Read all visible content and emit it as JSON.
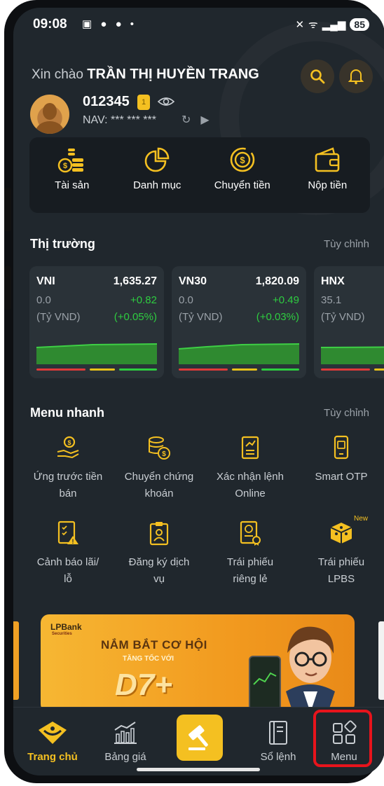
{
  "status_bar": {
    "time": "09:08",
    "battery": "85"
  },
  "header": {
    "greeting": "Xin chào",
    "user_name": "TRẦN THỊ HUYỀN TRANG",
    "account_number": "012345",
    "account_tag": "1",
    "nav_label": "NAV:",
    "nav_value": "*** *** ***"
  },
  "actions": [
    {
      "label": "Tài sản",
      "icon": "coins-icon"
    },
    {
      "label": "Danh mục",
      "icon": "pie-chart-icon"
    },
    {
      "label": "Chuyển tiền",
      "icon": "money-transfer-icon"
    },
    {
      "label": "Nộp tiền",
      "icon": "wallet-icon"
    }
  ],
  "market": {
    "title": "Thị trường",
    "customize": "Tùy chỉnh",
    "cards": [
      {
        "name": "VNI",
        "price": "1,635.27",
        "volume": "0.0",
        "unit": "(Tỷ VND)",
        "change": "+0.82",
        "percent": "(+0.05%)"
      },
      {
        "name": "VN30",
        "price": "1,820.09",
        "volume": "0.0",
        "unit": "(Tỷ VND)",
        "change": "+0.49",
        "percent": "(+0.03%)"
      },
      {
        "name": "HNX",
        "price": "",
        "volume": "35.1",
        "unit": "(Tỷ VND)",
        "change": "",
        "percent": ""
      }
    ]
  },
  "quick_menu": {
    "title": "Menu nhanh",
    "customize": "Tùy chỉnh",
    "items": [
      {
        "line1": "Ứng trước tiền",
        "line2": "bán",
        "icon": "cash-advance-icon"
      },
      {
        "line1": "Chuyển chứng",
        "line2": "khoán",
        "icon": "stock-transfer-icon"
      },
      {
        "line1": "Xác nhận lệnh",
        "line2": "Online",
        "icon": "order-confirm-icon"
      },
      {
        "line1": "Smart OTP",
        "line2": "",
        "icon": "smart-otp-icon"
      },
      {
        "line1": "Cảnh báo lãi/",
        "line2": "lỗ",
        "icon": "profit-alert-icon"
      },
      {
        "line1": "Đăng ký dịch",
        "line2": "vụ",
        "icon": "service-register-icon"
      },
      {
        "line1": "Trái phiếu",
        "line2": "riêng lẻ",
        "icon": "private-bond-icon"
      },
      {
        "line1": "Trái phiếu",
        "line2": "LPBS",
        "icon": "bond-box-icon",
        "badge": "New"
      }
    ]
  },
  "banner": {
    "brand": "LPBank",
    "brand_sub": "Securities",
    "headline": "NẮM BẮT CƠ HỘI",
    "subline": "TĂNG TỐC VỚI",
    "product": "D7+"
  },
  "bottom_nav": [
    {
      "label": "Trang chủ",
      "icon": "home-logo-icon",
      "active": true
    },
    {
      "label": "Bảng giá",
      "icon": "price-board-icon",
      "active": false
    },
    {
      "label": "",
      "icon": "gavel-icon",
      "active": false
    },
    {
      "label": "Sổ lệnh",
      "icon": "order-book-icon",
      "active": false
    },
    {
      "label": "Menu",
      "icon": "menu-grid-icon",
      "active": false
    }
  ],
  "colors": {
    "accent": "#f4c021",
    "background": "#20272d",
    "positive": "#2ecc40",
    "highlight": "#e8141c"
  }
}
